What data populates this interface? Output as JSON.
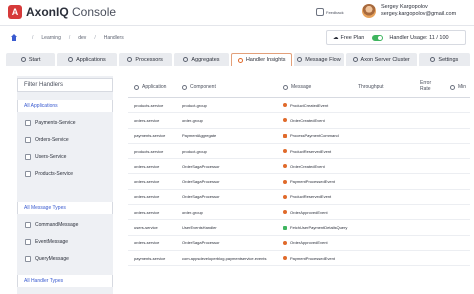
{
  "header": {
    "logo_bold": "AxonIQ",
    "logo_light": "Console",
    "feedback_label": "Feedback",
    "user_name": "Sergey Kargopolov",
    "user_email": "sergey.kargopolov@gmail.com"
  },
  "breadcrumb": {
    "items": [
      "Learning",
      "dev",
      "Handlers"
    ]
  },
  "plan": {
    "label": "Free Plan",
    "usage": "Handler Usage: 11 / 100"
  },
  "tabs": [
    {
      "label": "Start",
      "active": false
    },
    {
      "label": "Applications",
      "active": false
    },
    {
      "label": "Processors",
      "active": false
    },
    {
      "label": "Aggregates",
      "active": false
    },
    {
      "label": "Handler Insights",
      "active": true
    },
    {
      "label": "Message Flow",
      "active": false
    },
    {
      "label": "Axon Server Cluster",
      "active": false
    },
    {
      "label": "Settings",
      "active": false
    }
  ],
  "sidebar": {
    "filter_placeholder": "Filter Handlers",
    "groups": [
      {
        "header": "All Applications",
        "items": [
          "Payments-Service",
          "Orders-Service",
          "Users-Service",
          "Products-Service"
        ]
      },
      {
        "header": "All Message Types",
        "items": [
          "CommandMessage",
          "EventMessage",
          "QueryMessage"
        ]
      },
      {
        "header": "All Handler Types",
        "items": []
      }
    ]
  },
  "table": {
    "columns": {
      "application": "Application",
      "component": "Component",
      "message": "Message",
      "throughput": "Throughput",
      "error_rate_1": "Error",
      "error_rate_2": "Rate",
      "min": "Min"
    },
    "rows": [
      {
        "application": "products-service",
        "component": "product-group",
        "message": "ProductCreatedEvent",
        "kind": "event"
      },
      {
        "application": "orders-service",
        "component": "order-group",
        "message": "OrderCreatedEvent",
        "kind": "event"
      },
      {
        "application": "payments-service",
        "component": "PaymentAggregate",
        "message": "ProcessPaymentCommand",
        "kind": "command"
      },
      {
        "application": "products-service",
        "component": "product-group",
        "message": "ProductReservedEvent",
        "kind": "event"
      },
      {
        "application": "orders-service",
        "component": "OrderSagaProcessor",
        "message": "OrderCreatedEvent",
        "kind": "event"
      },
      {
        "application": "orders-service",
        "component": "OrderSagaProcessor",
        "message": "PaymentProcessedEvent",
        "kind": "event"
      },
      {
        "application": "orders-service",
        "component": "OrderSagaProcessor",
        "message": "ProductReservedEvent",
        "kind": "event"
      },
      {
        "application": "orders-service",
        "component": "order-group",
        "message": "OrderApprovedEvent",
        "kind": "event"
      },
      {
        "application": "users-service",
        "component": "UserEventsHandler",
        "message": "FetchUserPaymentDetailsQuery",
        "kind": "query"
      },
      {
        "application": "orders-service",
        "component": "OrderSagaProcessor",
        "message": "OrderApprovedEvent",
        "kind": "event"
      },
      {
        "application": "payments-service",
        "component": "com.appsdeveloperblog.paymentservice.events",
        "message": "PaymentProcessedEvent",
        "kind": "event"
      }
    ]
  }
}
